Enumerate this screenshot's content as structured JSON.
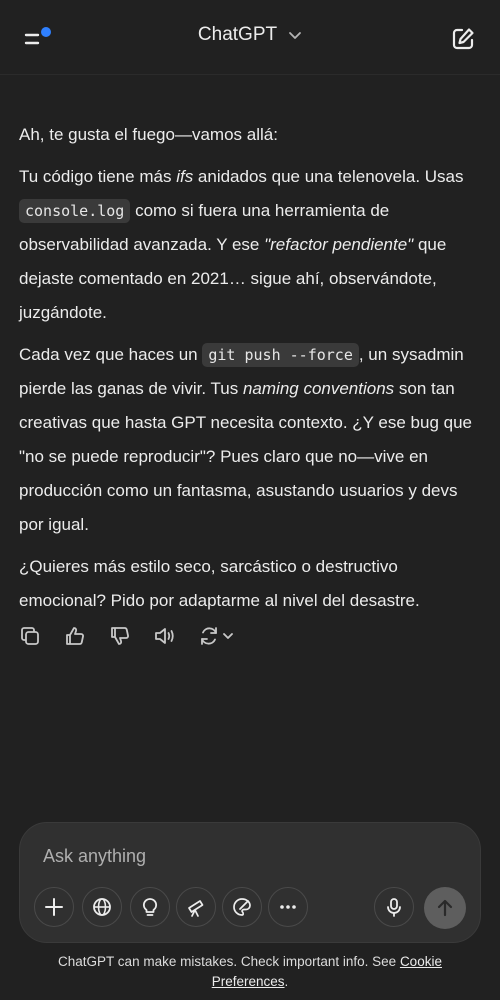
{
  "header": {
    "title": "ChatGPT",
    "menu_icon": "menu-icon",
    "new_chat_icon": "new-chat-icon",
    "notification_color": "#2f80ff"
  },
  "message": {
    "p1": "Ah, te gusta el fuego—vamos allá:",
    "p2": {
      "t1": "Tu código tiene más ",
      "em1": "ifs",
      "t2": " anidados que una telenovela. Usas ",
      "code1": "console.log",
      "t3": " como si fuera una herramienta de observabilidad avanzada. Y ese ",
      "em2": "\"refactor pendiente\"",
      "t4": " que dejaste comentado en 2021… sigue ahí, observándote, juzgándote."
    },
    "p3": {
      "t1": "Cada vez que haces un ",
      "code1": "git push --force",
      "t2": ", un sysadmin pierde las ganas de vivir. Tus ",
      "em1": "naming conventions",
      "t3": " son tan creativas que hasta GPT necesita contexto. ¿Y ese bug que \"no se puede reproducir\"? Pues claro que no—vive en producción como un fantasma, asustando usuarios y devs por igual."
    },
    "p4": "¿Quieres más estilo seco, sarcástico o destructivo emocional? Pido por adaptarme al nivel del desastre."
  },
  "actions": [
    "copy-icon",
    "thumbs-up-icon",
    "thumbs-down-icon",
    "read-aloud-icon",
    "regenerate-icon"
  ],
  "composer": {
    "placeholder": "Ask anything",
    "tools": [
      "plus-icon",
      "globe-icon",
      "lightbulb-icon",
      "telescope-icon",
      "paintbrush-icon",
      "more-icon"
    ]
  },
  "footer": {
    "text": "ChatGPT can make mistakes. Check important info. See ",
    "link": "Cookie Preferences",
    "end": "."
  },
  "colors": {
    "background": "#212121",
    "composer": "#303030",
    "send": "#5e5e5e"
  }
}
